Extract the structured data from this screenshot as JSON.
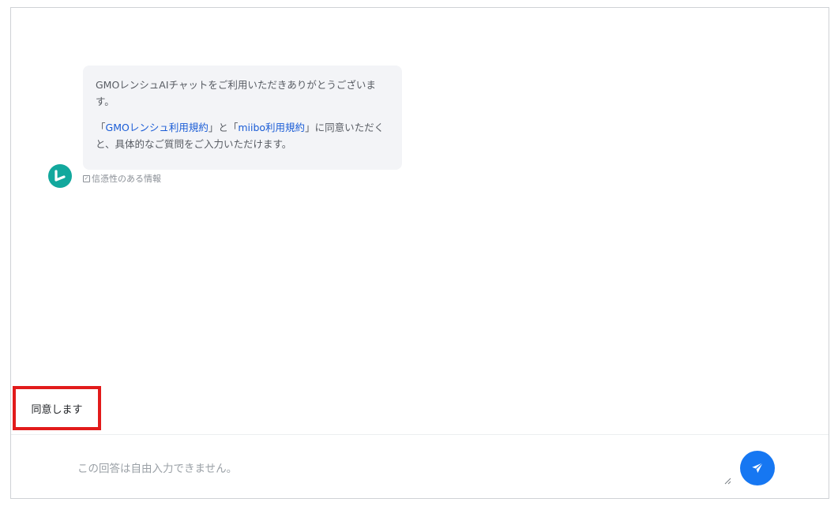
{
  "chat": {
    "bot_message": {
      "line1": "GMOレンシュAIチャットをご利用いただきありがとうございます。",
      "line2_prefix": "「",
      "link1": "GMOレンシュ利用規約",
      "line2_mid": "」と「",
      "link2": "miibo利用規約",
      "line2_suffix": "」に同意いただくと、具体的なご質問をご入力いただけます。"
    },
    "trust_label": "信憑性のある情報",
    "quick_reply": "同意します"
  },
  "composer": {
    "placeholder": "この回答は自由入力できません。"
  },
  "colors": {
    "accent": "#1677f2",
    "avatar": "#12a89d",
    "highlight_border": "#e21b1b",
    "link": "#1a5cd6"
  },
  "icons": {
    "avatar": "bot-avatar-icon",
    "trust": "checkbox-icon",
    "send": "send-icon"
  }
}
